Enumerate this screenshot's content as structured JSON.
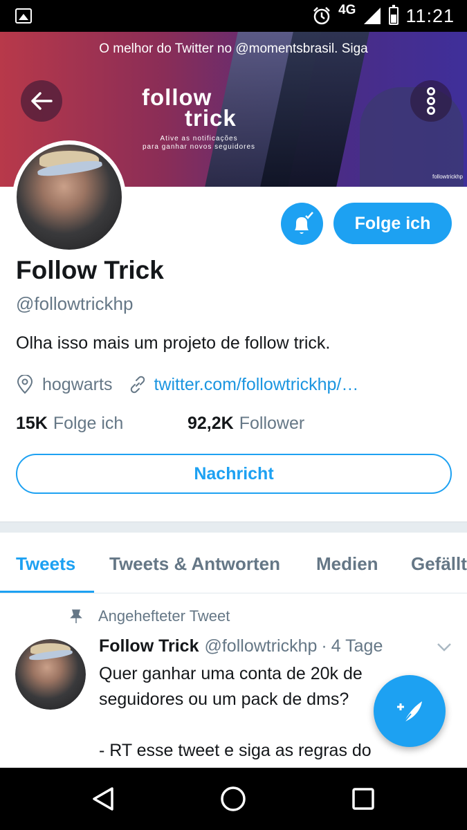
{
  "status_bar": {
    "network": "4G",
    "time": "11:21",
    "icons": [
      "image-icon",
      "alarm-icon",
      "signal-icon",
      "battery-icon"
    ]
  },
  "banner": {
    "promo_text": "O melhor do Twitter no @momentsbrasil. Siga",
    "logo_line1": "follow",
    "logo_line2": "trick",
    "tagline1": "Ative as notificações",
    "tagline2": "para ganhar novos seguidores",
    "watermark": "followtrickhp"
  },
  "profile": {
    "name": "Follow Trick",
    "handle": "@followtrickhp",
    "bio": "Olha isso mais um projeto de follow trick.",
    "location": "hogwarts",
    "link": "twitter.com/followtrickhp/…",
    "following_count": "15K",
    "following_label": "Folge ich",
    "followers_count": "92,2K",
    "followers_label": "Follower"
  },
  "actions": {
    "follow_label": "Folge ich",
    "message_label": "Nachricht"
  },
  "tabs": [
    {
      "label": "Tweets",
      "active": true
    },
    {
      "label": "Tweets & Antworten",
      "active": false
    },
    {
      "label": "Medien",
      "active": false
    },
    {
      "label": "Gefällt",
      "active": false
    }
  ],
  "pinned_tweet": {
    "pinned_label": "Angehefteter Tweet",
    "author_name": "Follow Trick",
    "author_handle": "@followtrickhp",
    "separator": "·",
    "time": "4 Tage",
    "text_line1": "Quer ganhar uma conta de 20k de",
    "text_line2": "seguidores ou um pack de dms?",
    "text_line3": "",
    "text_line4": "- RT esse tweet e siga as regras do"
  },
  "colors": {
    "accent": "#1da1f2",
    "link": "#1b95e0",
    "secondary_text": "#657786",
    "primary_text": "#14171a"
  }
}
